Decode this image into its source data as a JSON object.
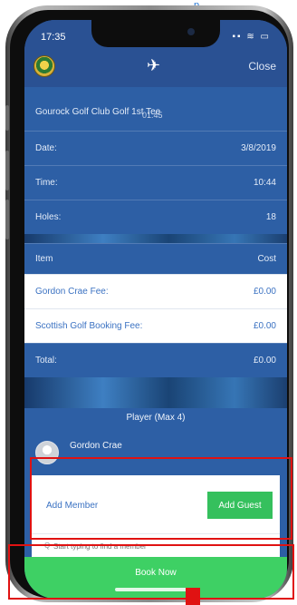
{
  "top_link": "p",
  "status": {
    "time": "17:35",
    "icons": "▪▪ ≋ ▭"
  },
  "appbar": {
    "close_label": "Close",
    "scroll_peek": "01:45"
  },
  "booking": {
    "venue": "Gourock Golf Club Golf 1st Tee",
    "rows": [
      {
        "label": "Date:",
        "value": "3/8/2019"
      },
      {
        "label": "Time:",
        "value": "10:44"
      },
      {
        "label": "Holes:",
        "value": "18"
      }
    ]
  },
  "costs": {
    "header": {
      "item": "Item",
      "cost": "Cost"
    },
    "items": [
      {
        "label": "Gordon Crae Fee:",
        "value": "£0.00"
      },
      {
        "label": "Scottish Golf Booking Fee:",
        "value": "£0.00"
      }
    ],
    "total": {
      "label": "Total:",
      "value": "£0.00"
    }
  },
  "players": {
    "header": "Player (Max 4)",
    "list": [
      {
        "name": "Gordon Crae"
      }
    ]
  },
  "add": {
    "member_label": "Add Member",
    "guest_label": "Add Guest",
    "search_placeholder": "Start typing to find a member"
  },
  "book_now_label": "Book Now",
  "colors": {
    "primary": "#2d5fa5",
    "accent_green": "#3ed064",
    "link_blue": "#3b72c2",
    "annotation_red": "#e01212"
  },
  "icons": {
    "search": "search-icon",
    "app": "flag-golfer-icon",
    "logo": "club-crest-icon"
  }
}
